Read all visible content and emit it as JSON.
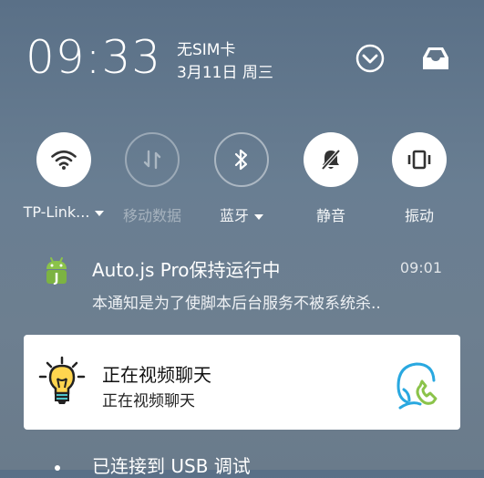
{
  "status": {
    "time": "09:33",
    "sim": "无SIM卡",
    "date": "3月11日 周三"
  },
  "header_icons": [
    "chevron-down-icon",
    "inbox-icon"
  ],
  "quick_tiles": [
    {
      "label": "TP-Link...",
      "icon": "wifi-icon",
      "active": true,
      "caret": true
    },
    {
      "label": "移动数据",
      "icon": "mobile-data-icon",
      "active": false,
      "caret": false
    },
    {
      "label": "蓝牙",
      "icon": "bluetooth-icon",
      "active": false,
      "caret": true
    },
    {
      "label": "静音",
      "icon": "mute-bell-icon",
      "active": true,
      "caret": false
    },
    {
      "label": "振动",
      "icon": "vibrate-icon",
      "active": true,
      "caret": false
    }
  ],
  "notifications": [
    {
      "title": "Auto.js Pro保持运行中",
      "time": "09:01",
      "body": "本通知是为了使脚本后台服务不被系统杀..",
      "icon": "android-j-icon"
    },
    {
      "title": "正在视频聊天",
      "subtitle": "正在视频聊天",
      "icon": "lightbulb-icon",
      "action_icon": "phone-call-icon"
    },
    {
      "title": "已连接到 USB 调试",
      "icon": "dot-icon"
    }
  ]
}
